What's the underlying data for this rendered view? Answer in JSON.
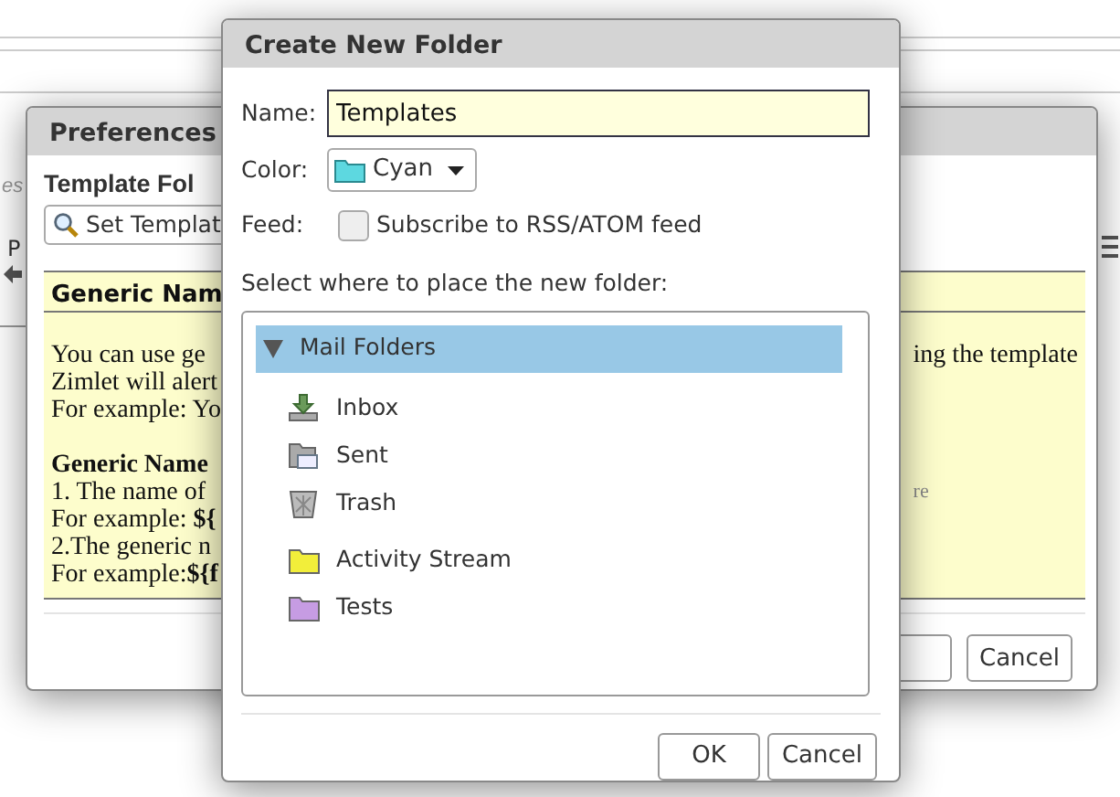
{
  "background": {
    "hint": "es",
    "tab_label": "P"
  },
  "preferences": {
    "title": "Preferences",
    "section_title": "Template Fol",
    "search_value": "Set Templat",
    "panel_header": "Generic Nam",
    "panel_lines_left": [
      {
        "text": "You can use ge",
        "kind": "plain"
      },
      {
        "text": "Zimlet will alert",
        "kind": "plain"
      },
      {
        "text": "For example: Yo",
        "kind": "plain"
      },
      {
        "text": "Generic Name",
        "kind": "heading"
      },
      {
        "text": "1. The name of",
        "kind": "plain"
      },
      {
        "text": "For example: **${**",
        "kind": "plain"
      },
      {
        "text": "2.The generic n",
        "kind": "plain"
      },
      {
        "text": "For example:**${f**",
        "kind": "plain"
      }
    ],
    "panel_lines_right": [
      {
        "text": "ing the template",
        "kind": "plain"
      },
      {
        "text": "re",
        "kind": "faint"
      }
    ],
    "cancel_label": "Cancel"
  },
  "dialog": {
    "title": "Create New Folder",
    "name_label": "Name:",
    "name_value": "Templates",
    "color_label": "Color:",
    "color_value": "Cyan",
    "feed_label": "Feed:",
    "feed_option": {
      "label": "Subscribe to RSS/ATOM feed",
      "checked": false
    },
    "tree_label": "Select where to place the new folder:",
    "tree": [
      {
        "label": "Mail Folders",
        "kind": "root",
        "expanded": true,
        "selected": true,
        "children": [
          {
            "label": "Inbox",
            "kind": "inbox",
            "selected": false
          },
          {
            "label": "Sent",
            "kind": "sent",
            "selected": false
          },
          {
            "label": "Trash",
            "kind": "trash",
            "selected": false
          },
          {
            "label": "Activity Stream",
            "kind": "folder",
            "color": "#f2ee3a",
            "selected": false
          },
          {
            "label": "Tests",
            "kind": "folder",
            "color": "#c69ce3",
            "selected": false
          }
        ]
      }
    ],
    "buttons": [
      "OK",
      "Cancel"
    ]
  }
}
